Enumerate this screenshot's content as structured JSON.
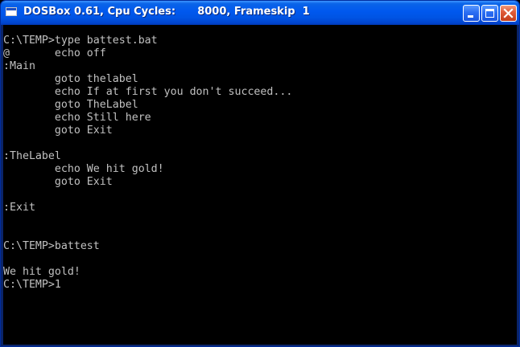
{
  "window": {
    "title": "DOSBox 0.61, Cpu Cycles:      8000, Frameskip  1"
  },
  "terminal": {
    "lines": [
      "C:\\TEMP>type battest.bat",
      "@       echo off",
      ":Main",
      "        goto thelabel",
      "        echo If at first you don't succeed...",
      "        goto TheLabel",
      "        echo Still here",
      "        goto Exit",
      "",
      ":TheLabel",
      "        echo We hit gold!",
      "        goto Exit",
      "",
      ":Exit",
      "",
      "",
      "C:\\TEMP>battest",
      "",
      "We hit gold!",
      "C:\\TEMP>1"
    ]
  }
}
